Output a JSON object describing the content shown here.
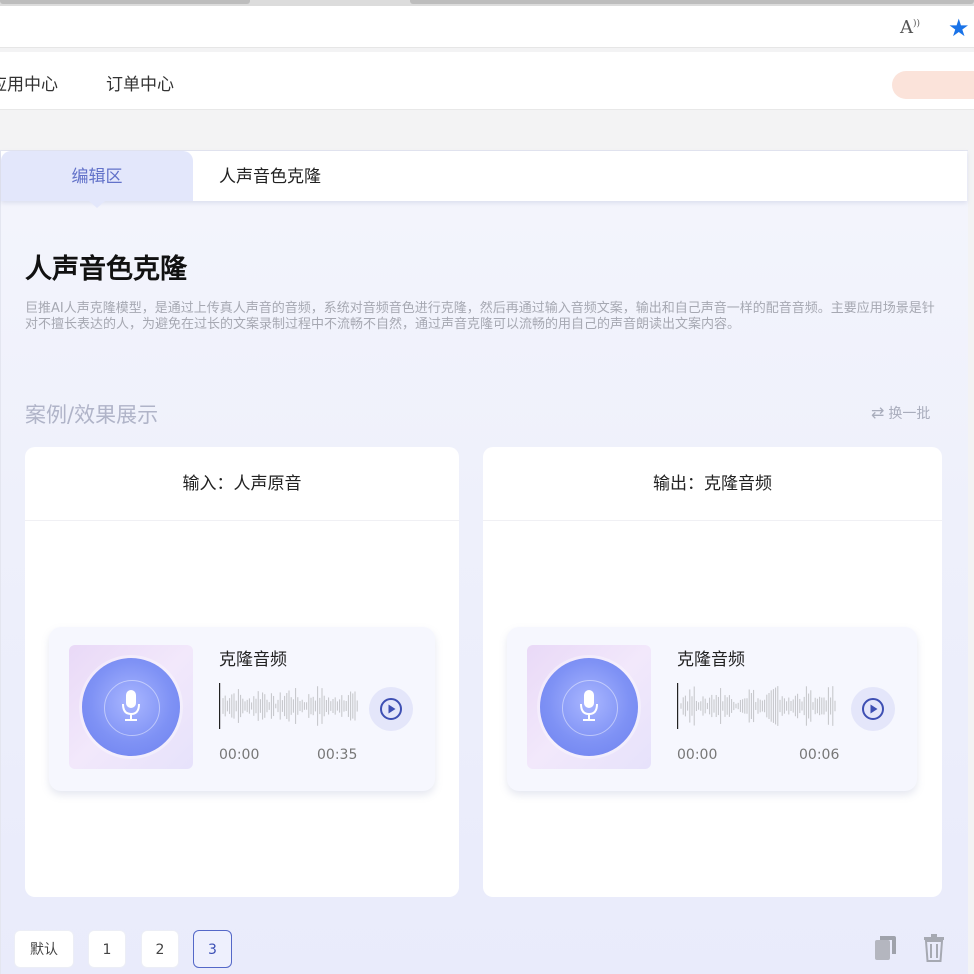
{
  "browser": {
    "read_aloud_icon": "read-aloud-icon",
    "favorite_icon": "star-icon",
    "accent": "#1a73e8"
  },
  "header": {
    "nav": [
      {
        "label": "应用中心"
      },
      {
        "label": "订单中心"
      }
    ]
  },
  "tabs": {
    "edit_label": "编辑区",
    "current_label": "人声音色克隆"
  },
  "main": {
    "title": "人声音色克隆",
    "description": "巨推AI人声克隆模型，是通过上传真人声音的音频，系统对音频音色进行克隆，然后再通过输入音频文案，输出和自己声音一样的配音音频。主要应用场景是针对不擅长表达的人，为避免在过长的文案录制过程中不流畅不自然，通过声音克隆可以流畅的用自己的声音朗读出文案内容。",
    "section_title": "案例/效果展示",
    "refresh_label": "换一批"
  },
  "cards": [
    {
      "header": "输入：人声原音",
      "player": {
        "name": "克隆音频",
        "time_start": "00:00",
        "time_end": "00:35"
      }
    },
    {
      "header": "输出：克隆音频",
      "player": {
        "name": "克隆音频",
        "time_start": "00:00",
        "time_end": "00:06"
      }
    }
  ],
  "pagination": {
    "default_label": "默认",
    "pages": [
      "1",
      "2",
      "3"
    ],
    "active_page": "3"
  },
  "colors": {
    "accent": "#5468c8",
    "tab_bg": "#e3e7fb",
    "header_pill": "#fbe3da"
  }
}
